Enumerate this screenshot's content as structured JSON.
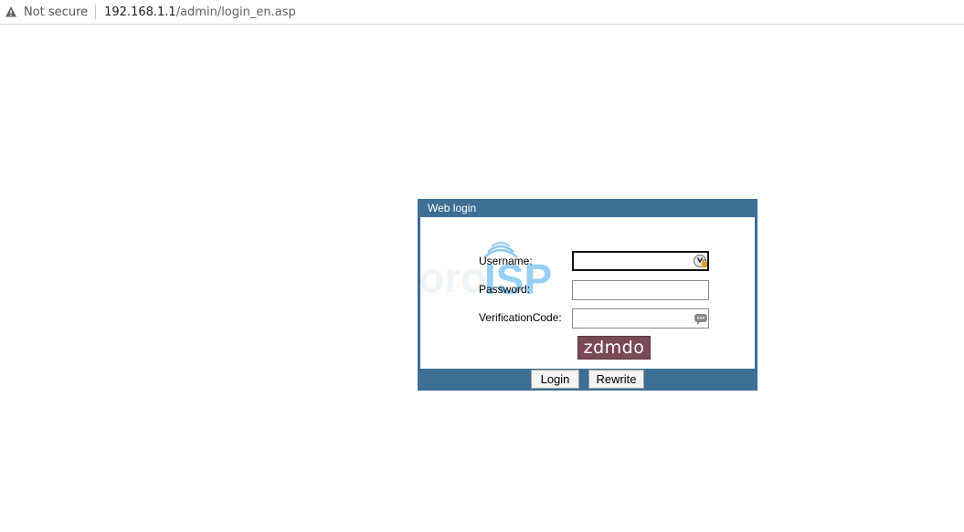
{
  "browser": {
    "security_label": "Not secure",
    "url_host": "192.168.1.1",
    "url_path": "/admin/login_en.asp",
    "warning_icon": "warning-triangle-icon"
  },
  "login": {
    "title": "Web login",
    "watermark_text_left": "Foro",
    "watermark_text_right": "ISP",
    "username_label": "Username:",
    "username_value": "",
    "password_label": "Password:",
    "password_value": "",
    "verification_label": "VerificationCode:",
    "verification_value": "",
    "captcha_text": "zdmdo",
    "login_button": "Login",
    "rewrite_button": "Rewrite",
    "password_manager_icon": "key-lock-icon",
    "autofill_icon": "ellipsis-bubble-icon"
  },
  "colors": {
    "frame": "#3d6e93",
    "captcha_bg": "#7a4a56",
    "watermark": "#5aaee6"
  }
}
